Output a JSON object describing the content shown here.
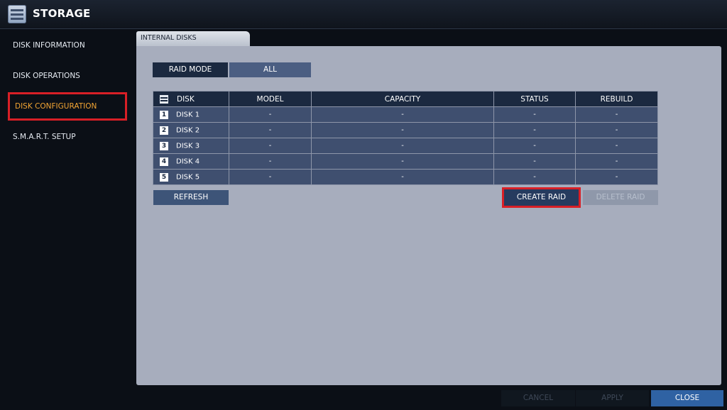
{
  "window": {
    "title": "STORAGE",
    "icon": "storage-icon"
  },
  "sidebar": {
    "items": [
      {
        "label": "DISK INFORMATION"
      },
      {
        "label": "DISK OPERATIONS"
      },
      {
        "label": "DISK CONFIGURATION",
        "active": true
      },
      {
        "label": "S.M.A.R.T. SETUP"
      }
    ]
  },
  "tabs": [
    {
      "label": "INTERNAL DISKS"
    }
  ],
  "raid": {
    "label": "RAID MODE",
    "value": "ALL"
  },
  "table": {
    "headers": [
      "DISK",
      "MODEL",
      "CAPACITY",
      "STATUS",
      "REBUILD"
    ],
    "rows": [
      {
        "num": "1",
        "disk": "DISK 1",
        "model": "-",
        "capacity": "-",
        "status": "-",
        "rebuild": "-"
      },
      {
        "num": "2",
        "disk": "DISK 2",
        "model": "-",
        "capacity": "-",
        "status": "-",
        "rebuild": "-"
      },
      {
        "num": "3",
        "disk": "DISK 3",
        "model": "-",
        "capacity": "-",
        "status": "-",
        "rebuild": "-"
      },
      {
        "num": "4",
        "disk": "DISK 4",
        "model": "-",
        "capacity": "-",
        "status": "-",
        "rebuild": "-"
      },
      {
        "num": "5",
        "disk": "DISK 5",
        "model": "-",
        "capacity": "-",
        "status": "-",
        "rebuild": "-"
      }
    ]
  },
  "buttons": {
    "refresh": "REFRESH",
    "create_raid": "CREATE RAID",
    "delete_raid": "DELETE RAID",
    "cancel": "CANCEL",
    "apply": "APPLY",
    "close": "CLOSE"
  },
  "colors": {
    "highlight": "#d81f26",
    "active_text": "#f3a533",
    "header_bg": "#1b2940",
    "cell_bg": "#3f4f6f",
    "close_bg": "#2f62a3"
  }
}
